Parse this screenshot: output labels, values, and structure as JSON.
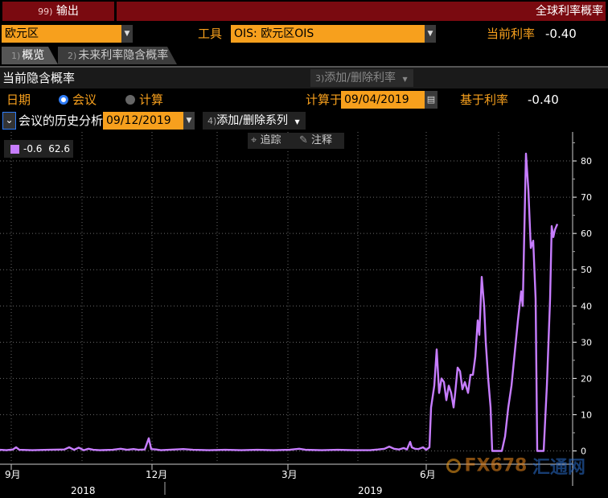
{
  "topbar": {
    "output_num": "99)",
    "output_label": "输出",
    "title": "全球利率概率"
  },
  "row2": {
    "region_value": "欧元区",
    "tool_label": "工具",
    "instrument_value": "OIS: 欧元区OIS",
    "current_rate_label": "当前利率",
    "current_rate_value": "-0.40"
  },
  "tabs": [
    {
      "num": "1)",
      "label": "概览"
    },
    {
      "num": "2)",
      "label": "未来利率隐含概率"
    }
  ],
  "section": {
    "title": "当前隐含概率",
    "add_remove_rate_num": "3)",
    "add_remove_rate_label": "添加/删除利率"
  },
  "date_row": {
    "date_label": "日期",
    "meeting_option": "会议",
    "compute_option": "计算",
    "compute_on_label": "计算于",
    "compute_date": "09/04/2019",
    "base_rate_label": "基于利率",
    "base_rate_value": "-0.40"
  },
  "history_row": {
    "label": "会议的历史分析",
    "date_value": "09/12/2019",
    "add_series_num": "4)",
    "add_series_label": "添加/删除系列"
  },
  "chart_toolbar": {
    "track_label": "追踪",
    "annotate_label": "注释"
  },
  "legend": {
    "label": "-0.6",
    "value": "62.6",
    "color": "#c77dff"
  },
  "watermark": {
    "text": "FX678",
    "text2": "汇通网"
  },
  "colors": {
    "accent_orange": "#f7a01d",
    "topbar_red": "#7a0a10",
    "series_purple": "#c77dff"
  },
  "chart_data": {
    "type": "line",
    "title": "",
    "xlabel": "",
    "ylabel": "",
    "ylim": [
      -3,
      88
    ],
    "yticks": [
      0,
      10,
      20,
      30,
      40,
      50,
      60,
      70,
      80
    ],
    "grid": true,
    "legend_position": "top-left",
    "x_tick_labels": [
      "9月",
      "12月",
      "3月",
      "6月"
    ],
    "x_year_labels": [
      "2018",
      "2019"
    ],
    "x_axis_title_partial": "",
    "series": [
      {
        "name": "-0.6",
        "last_value": 62.6,
        "points": [
          [
            0,
            0.3
          ],
          [
            8,
            0.2
          ],
          [
            16,
            0.4
          ],
          [
            20,
            1.0
          ],
          [
            24,
            0.3
          ],
          [
            40,
            0.2
          ],
          [
            60,
            0.3
          ],
          [
            80,
            0.4
          ],
          [
            86,
            1.0
          ],
          [
            92,
            0.3
          ],
          [
            98,
            0.9
          ],
          [
            104,
            0.2
          ],
          [
            110,
            0.6
          ],
          [
            116,
            0.3
          ],
          [
            124,
            0.2
          ],
          [
            140,
            0.3
          ],
          [
            150,
            0.6
          ],
          [
            158,
            0.3
          ],
          [
            166,
            0.5
          ],
          [
            172,
            0.3
          ],
          [
            180,
            0.4
          ],
          [
            185,
            3.5
          ],
          [
            188,
            0.5
          ],
          [
            194,
            0.4
          ],
          [
            200,
            0.2
          ],
          [
            210,
            0.3
          ],
          [
            228,
            0.5
          ],
          [
            240,
            0.3
          ],
          [
            260,
            0.2
          ],
          [
            280,
            0.3
          ],
          [
            300,
            0.2
          ],
          [
            320,
            0.3
          ],
          [
            340,
            0.2
          ],
          [
            360,
            0.3
          ],
          [
            372,
            0.6
          ],
          [
            380,
            0.3
          ],
          [
            400,
            0.2
          ],
          [
            420,
            0.3
          ],
          [
            440,
            0.2
          ],
          [
            460,
            0.2
          ],
          [
            470,
            0.4
          ],
          [
            478,
            0.6
          ],
          [
            484,
            1.2
          ],
          [
            490,
            0.6
          ],
          [
            496,
            0.4
          ],
          [
            502,
            0.8
          ],
          [
            506,
            0.4
          ],
          [
            510,
            2.5
          ],
          [
            512,
            1.0
          ],
          [
            516,
            0.6
          ],
          [
            520,
            0.5
          ],
          [
            526,
            1.0
          ],
          [
            530,
            0.3
          ],
          [
            534,
            1.0
          ],
          [
            536,
            12
          ],
          [
            540,
            18
          ],
          [
            543,
            28
          ],
          [
            546,
            16
          ],
          [
            549,
            20
          ],
          [
            552,
            19
          ],
          [
            555,
            14
          ],
          [
            558,
            18
          ],
          [
            561,
            16
          ],
          [
            564,
            12
          ],
          [
            566,
            16
          ],
          [
            569,
            23
          ],
          [
            572,
            22
          ],
          [
            575,
            17
          ],
          [
            578,
            19
          ],
          [
            582,
            16
          ],
          [
            585,
            21
          ],
          [
            588,
            21
          ],
          [
            591,
            26
          ],
          [
            594,
            36
          ],
          [
            596,
            32
          ],
          [
            599,
            48
          ],
          [
            602,
            40
          ],
          [
            604,
            30
          ],
          [
            607,
            20
          ],
          [
            610,
            12
          ],
          [
            612,
            0
          ],
          [
            616,
            0
          ],
          [
            620,
            0
          ],
          [
            624,
            0
          ],
          [
            628,
            4
          ],
          [
            632,
            12
          ],
          [
            636,
            18
          ],
          [
            640,
            27
          ],
          [
            644,
            36
          ],
          [
            648,
            44
          ],
          [
            650,
            40
          ],
          [
            654,
            82
          ],
          [
            657,
            72
          ],
          [
            660,
            56
          ],
          [
            663,
            58
          ],
          [
            666,
            42
          ],
          [
            668,
            0
          ],
          [
            672,
            0
          ],
          [
            676,
            0
          ],
          [
            680,
            18
          ],
          [
            684,
            42
          ],
          [
            686,
            62
          ],
          [
            688,
            59
          ],
          [
            690,
            61
          ],
          [
            693,
            62.6
          ]
        ]
      }
    ]
  }
}
